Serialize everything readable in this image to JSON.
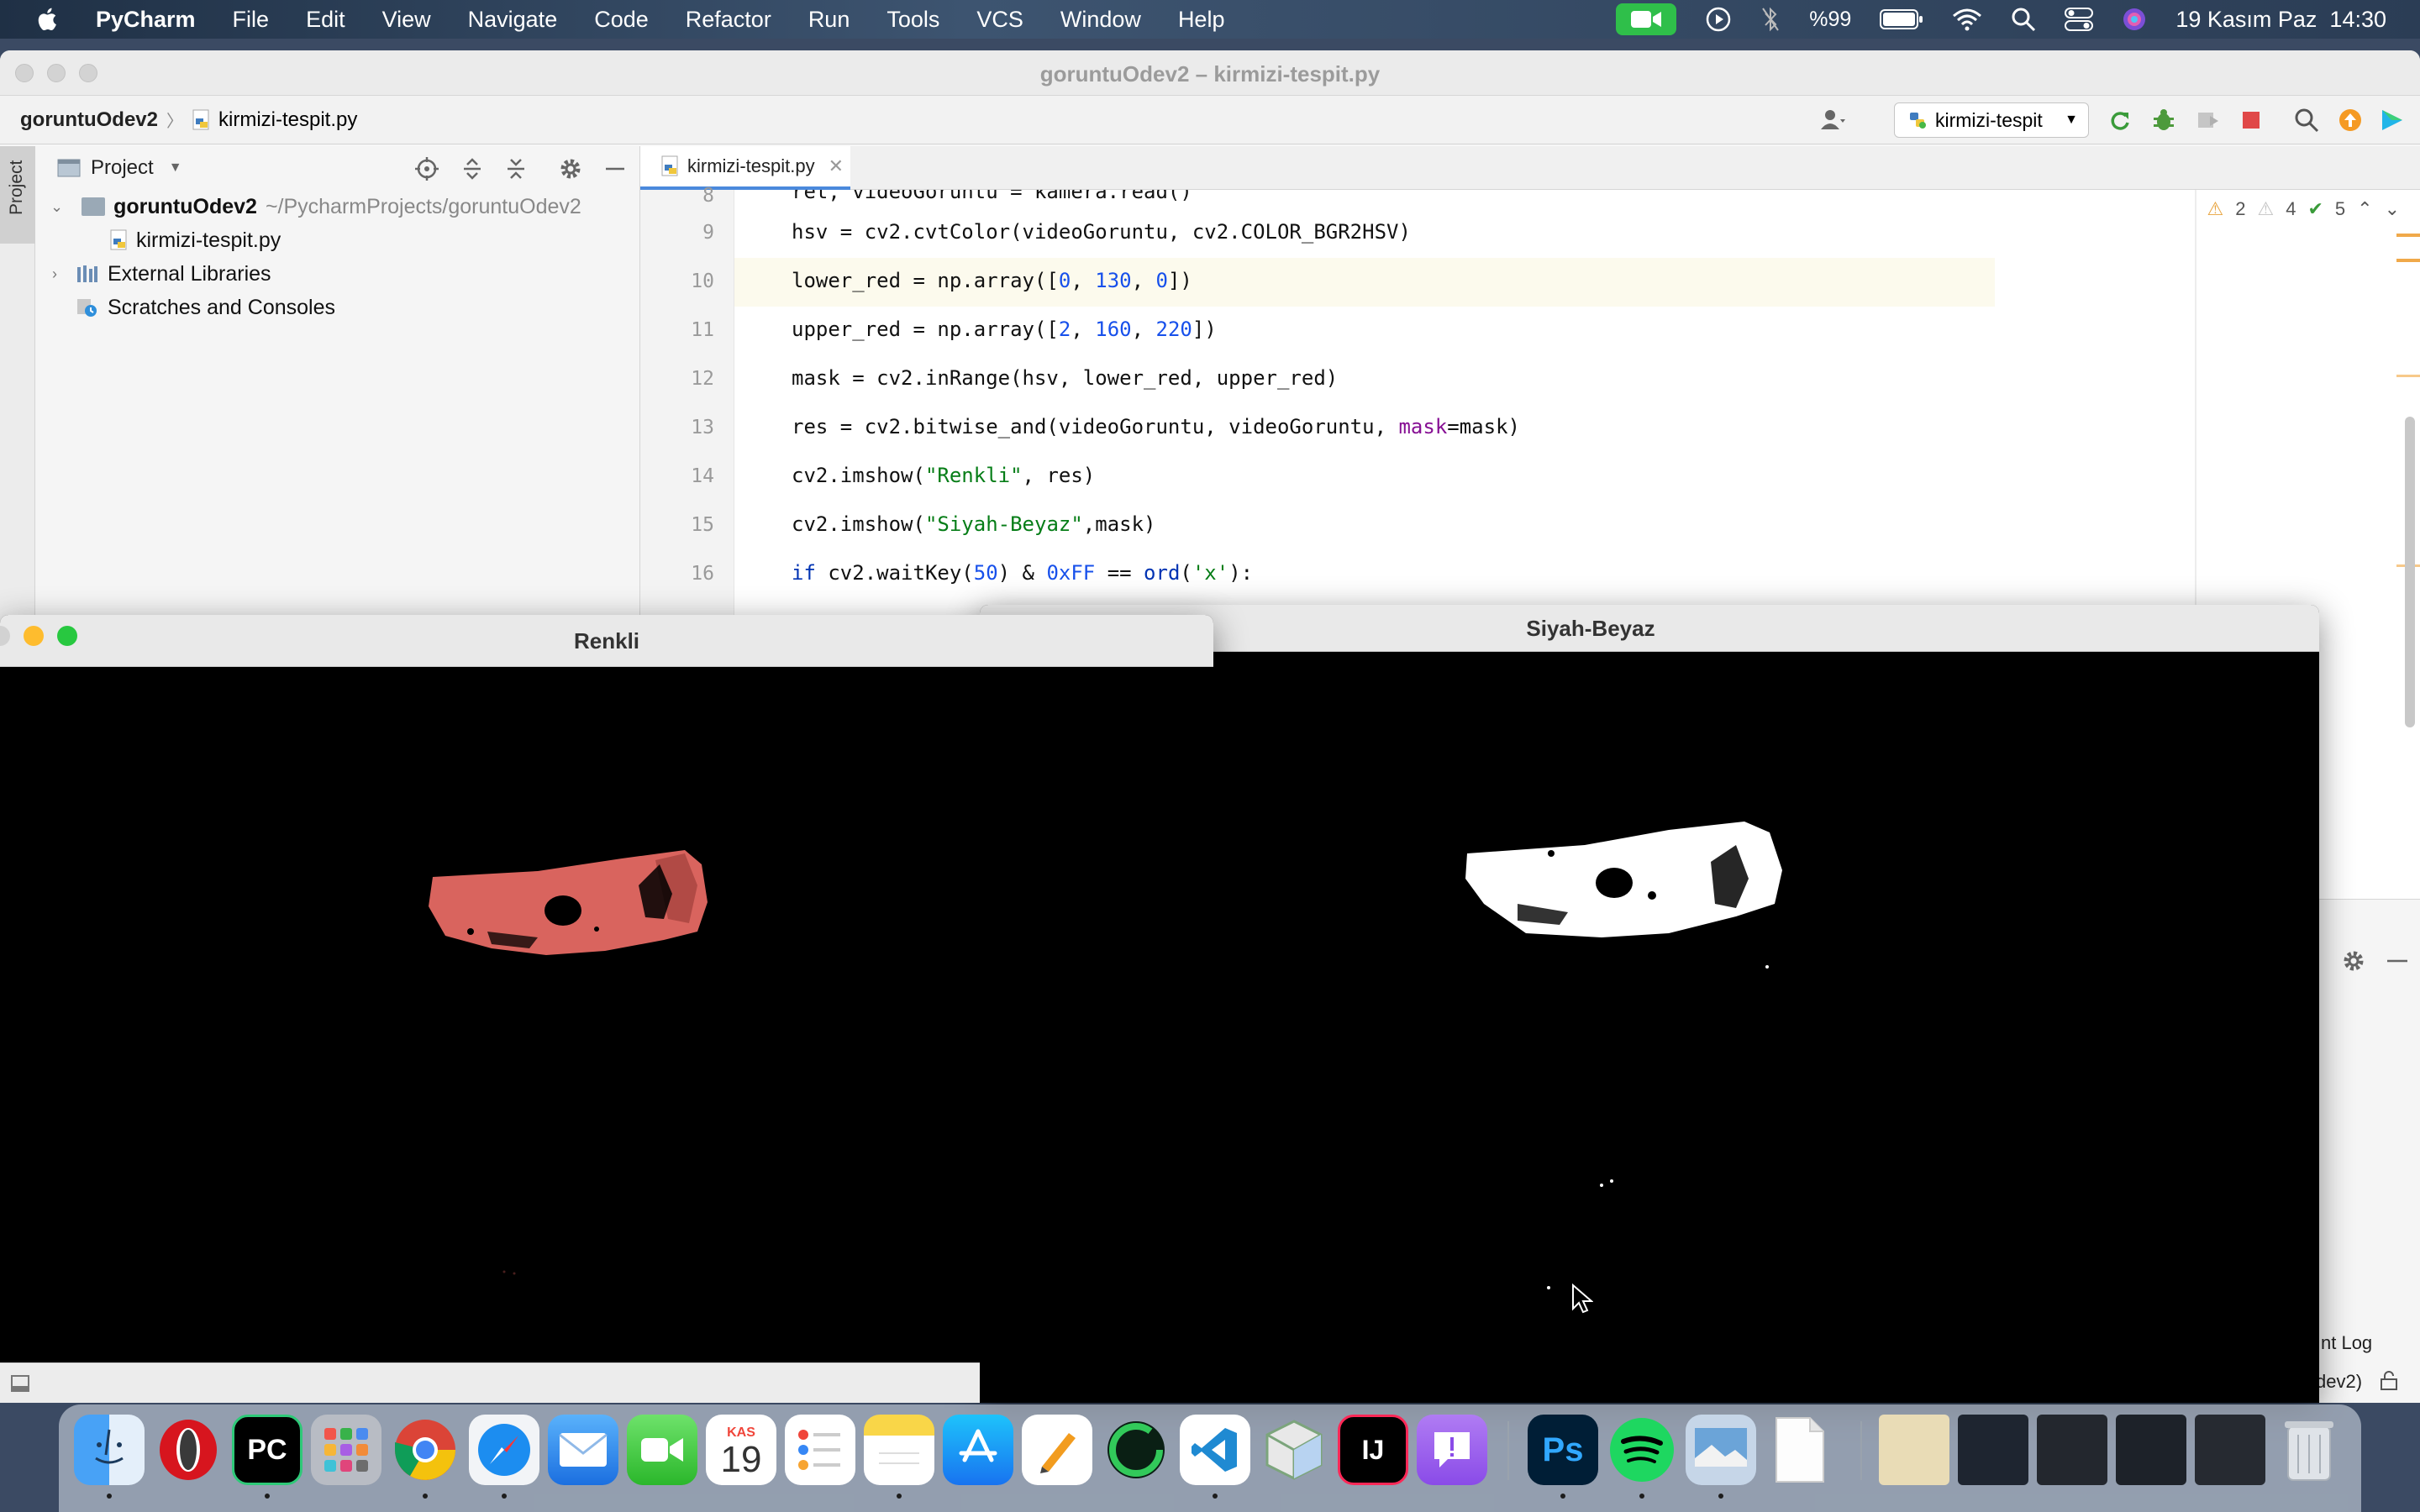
{
  "menubar": {
    "app_name": "PyCharm",
    "menus": [
      "File",
      "Edit",
      "View",
      "Navigate",
      "Code",
      "Refactor",
      "Run",
      "Tools",
      "VCS",
      "Window",
      "Help"
    ],
    "battery": "%99",
    "datetime": "19 Kasım Paz  14:30"
  },
  "ide": {
    "window_title": "goruntuOdev2 – kirmizi-tespit.py",
    "breadcrumb": {
      "project": "goruntuOdev2",
      "file": "kirmizi-tespit.py"
    },
    "run_config": "kirmizi-tespit",
    "tool_stripe_label": "Project",
    "project_panel": {
      "header": "Project",
      "tree": [
        {
          "name": "goruntuOdev2",
          "path": "~/PycharmProjects/goruntuOdev2"
        },
        {
          "name": "kirmizi-tespit.py"
        },
        {
          "name": "External Libraries"
        },
        {
          "name": "Scratches and Consoles"
        }
      ]
    },
    "editor_tab": "kirmizi-tespit.py",
    "inspections": {
      "errors": "2",
      "warnings": "4",
      "ok": "5"
    },
    "partial_top_line": "ret, videoGoruntu = kamera.read()",
    "line_numbers": [
      "8",
      "9",
      "10",
      "11",
      "12",
      "13",
      "14",
      "15",
      "16"
    ],
    "bottom_right_labels": {
      "event_log": "nt Log",
      "interp": "dev2)"
    }
  },
  "code": {
    "l9": {
      "pre": "hsv = cv2.cvtColor(videoGoruntu, cv2.COLOR_BGR2HSV)"
    },
    "l10": {
      "pre": "lower_red = np.array([",
      "n1": "0",
      "s1": ", ",
      "n2": "130",
      "s2": ", ",
      "n3": "0",
      "post": "])"
    },
    "l11": {
      "pre": "upper_red = np.array([",
      "n1": "2",
      "s1": ", ",
      "n2": "160",
      "s2": ", ",
      "n3": "220",
      "post": "])"
    },
    "l12": {
      "pre": "mask = cv2.inRange(hsv, lower_red, upper_red)"
    },
    "l13": {
      "pre": "res = cv2.bitwise_and(videoGoruntu, videoGoruntu, ",
      "param": "mask",
      "post": "=mask)"
    },
    "l14": {
      "pre": "cv2.imshow(",
      "str": "\"Renkli\"",
      "post": ", res)"
    },
    "l15": {
      "pre": "cv2.imshow(",
      "str": "\"Siyah-Beyaz\"",
      "post": ",mask)"
    },
    "l16": {
      "kw": "if",
      "pre": " cv2.waitKey(",
      "n1": "50",
      "mid": ") & ",
      "n2": "0xFF",
      "mid2": " == ",
      "fn": "ord",
      "s1": "(",
      "str": "'x'",
      "post": "):"
    }
  },
  "windows": {
    "renkli": {
      "title": "Renkli"
    },
    "siyah_beyaz": {
      "title": "Siyah-Beyaz"
    }
  },
  "dock": {
    "calendar_month": "KAS",
    "calendar_day": "19",
    "pycharm_label": "PC",
    "intellij_label": "IJ",
    "ps_label": "Ps"
  },
  "colors": {
    "accent_blue": "#4a89dc",
    "keyword": "#0033b3",
    "number": "#1750eb",
    "string": "#067d17",
    "red_object": "#d9645e"
  }
}
